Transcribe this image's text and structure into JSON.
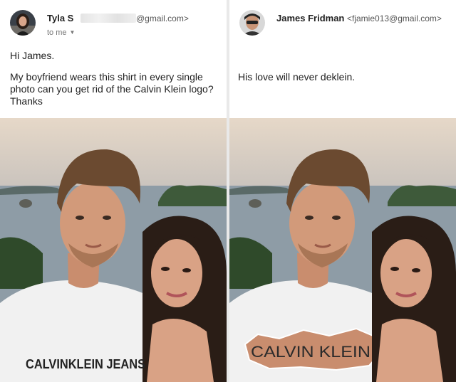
{
  "left_email": {
    "sender_name": "Tyla S",
    "sender_email_suffix": "@gmail.com>",
    "recipient_label": "to me",
    "greeting": "Hi James.",
    "message": "My boyfriend wears this shirt in every single photo can you get rid of the Calvin Klein logo? Thanks",
    "shirt_text": "CALVINKLEIN JEANS",
    "icons": [
      "avatar-woman",
      "chevron-down-icon"
    ]
  },
  "right_email": {
    "sender_name": "James Fridman",
    "sender_email": "<fjamie013@gmail.com>",
    "message": "His love will never deklein.",
    "shirt_text": "CALVIN KLEIN",
    "icons": [
      "avatar-man"
    ]
  },
  "colors": {
    "sky": "#e9dccd",
    "sea": "#8a9aa6",
    "shirt": "#f2f2f2",
    "skin": "#d79b7b",
    "hair": "#6b4a30"
  }
}
